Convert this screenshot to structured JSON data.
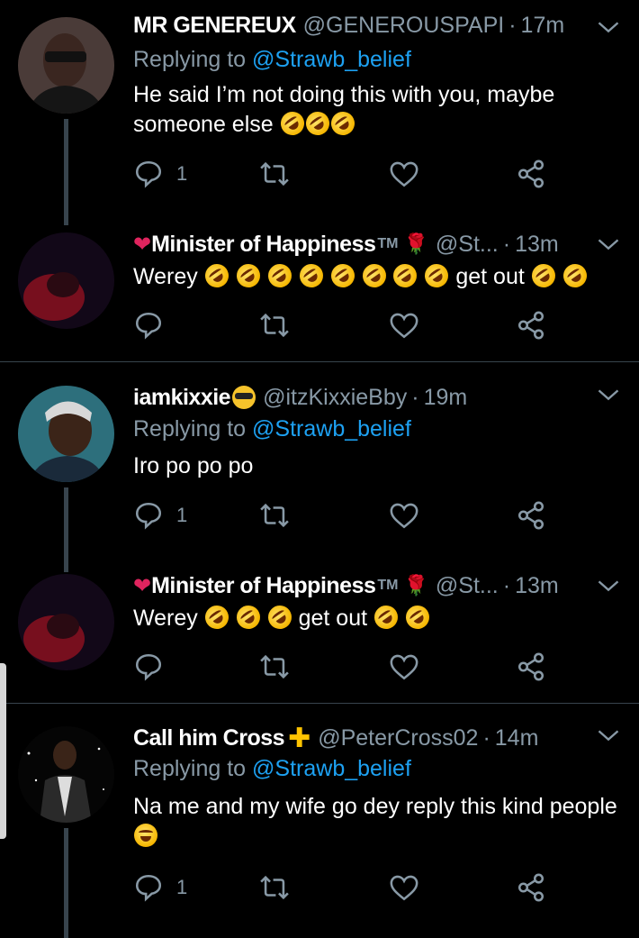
{
  "colors": {
    "background": "#000000",
    "muted": "#8899a6",
    "link": "#1da1f2",
    "divider": "#38444d"
  },
  "tweets": [
    {
      "name": "MR GENEREUX",
      "handle": "@GENEROUSPAPI",
      "time": "17m",
      "replying_prefix": "Replying to",
      "replying_to": "@Strawb_belief",
      "text": "He said I’m not doing this with you, maybe someone else",
      "reply_count": "1"
    },
    {
      "name": "Minister of Happiness",
      "handle": "@St...",
      "time": "13m",
      "text_before": "Werey",
      "text_after": "get out",
      "reply_count": ""
    },
    {
      "name": "iamkixxie",
      "handle": "@itzKixxieBby",
      "time": "19m",
      "replying_prefix": "Replying to",
      "replying_to": "@Strawb_belief",
      "text": "Iro po po po",
      "reply_count": "1"
    },
    {
      "name": "Minister of Happiness",
      "handle": "@St...",
      "time": "13m",
      "text_before": "Werey",
      "text_after": "get out",
      "reply_count": ""
    },
    {
      "name": "Call him Cross",
      "handle": "@PeterCross02",
      "time": "14m",
      "replying_prefix": "Replying to",
      "replying_to": "@Strawb_belief",
      "text": "Na me and my wife go dey reply this kind people",
      "reply_count": "1"
    }
  ],
  "icons": {
    "reply": "reply-icon",
    "retweet": "retweet-icon",
    "like": "like-icon",
    "share": "share-icon",
    "menu": "chevron-down-icon"
  },
  "dot": "·",
  "tm_mark": "TM"
}
